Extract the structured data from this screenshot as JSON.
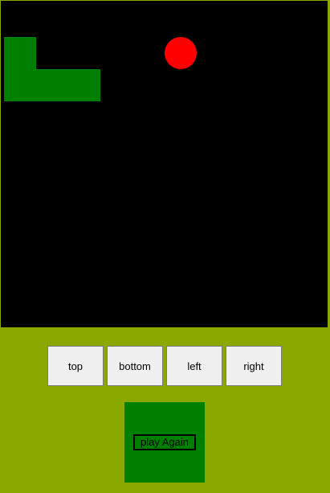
{
  "theme": {
    "background": "#8aa900",
    "board_color": "#000000",
    "snake_color": "#008000",
    "food_color": "#ff0000"
  },
  "controls": {
    "top_label": "top",
    "bottom_label": "bottom",
    "left_label": "left",
    "right_label": "right"
  },
  "game_over": {
    "play_again_label": "play Again"
  }
}
